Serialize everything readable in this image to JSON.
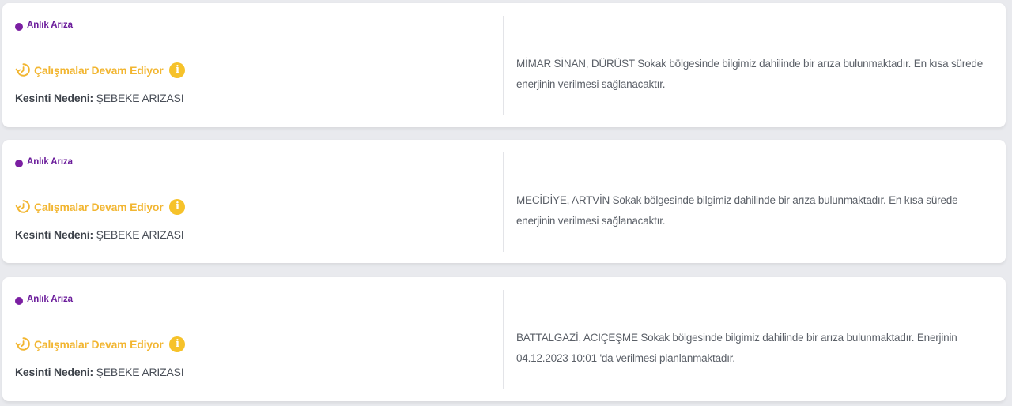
{
  "outages": [
    {
      "tag": "Anlık Arıza",
      "status": "Çalışmalar Devam Ediyor",
      "reason_label": "Kesinti Nedeni:",
      "reason_value": "ŞEBEKE ARIZASI",
      "description": "MİMAR SİNAN, DÜRÜST Sokak bölgesinde bilgimiz dahilinde bir arıza bulunmaktadır. En kısa sürede enerjinin verilmesi sağlanacaktır."
    },
    {
      "tag": "Anlık Arıza",
      "status": "Çalışmalar Devam Ediyor",
      "reason_label": "Kesinti Nedeni:",
      "reason_value": "ŞEBEKE ARIZASI",
      "description": "MECİDİYE, ARTVİN Sokak bölgesinde bilgimiz dahilinde bir arıza bulunmaktadır. En kısa sürede enerjinin verilmesi sağlanacaktır."
    },
    {
      "tag": "Anlık Arıza",
      "status": "Çalışmalar Devam Ediyor",
      "reason_label": "Kesinti Nedeni:",
      "reason_value": "ŞEBEKE ARIZASI",
      "description": "BATTALGAZİ, ACIÇEŞME Sokak bölgesinde bilgimiz dahilinde bir arıza bulunmaktadır. Enerjinin 04.12.2023 10:01 'da verilmesi planlanmaktadır."
    }
  ],
  "icons": {
    "tag_dot": "dot-icon",
    "status": "clock-refresh-icon",
    "info": "info-icon"
  },
  "colors": {
    "tag": "#7b1fa2",
    "status": "#f2b632",
    "info": "#f6c22a"
  }
}
